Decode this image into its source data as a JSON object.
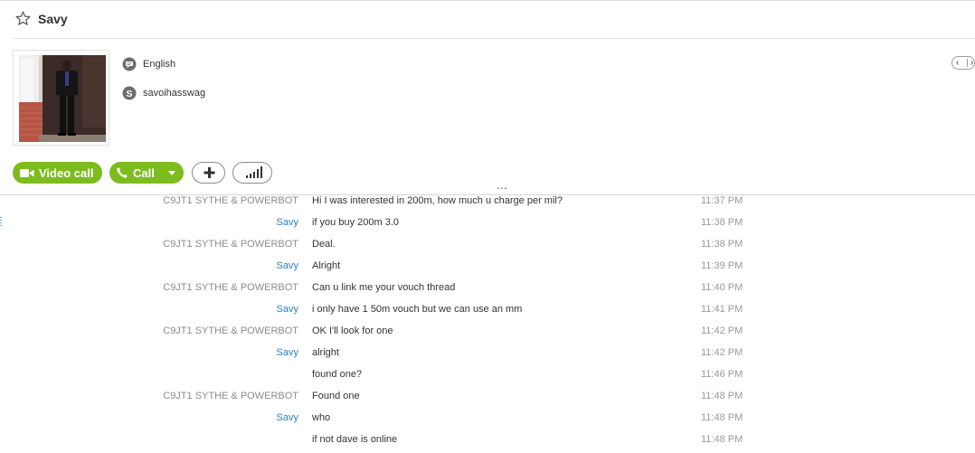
{
  "header": {
    "contact_name": "Savy"
  },
  "profile": {
    "language": "English",
    "skype_name": "savoihasswag"
  },
  "actions": {
    "video_call_label": "Video call",
    "call_label": "Call"
  },
  "colors": {
    "accent_green": "#7cbc1e",
    "self_name_blue": "#2b7ec5",
    "other_name_gray": "#8c8c8c",
    "timestamp_gray": "#9a9a9a"
  },
  "icons": [
    "star-icon",
    "chat-bubble-icon",
    "skype-icon",
    "video-camera-icon",
    "phone-icon",
    "plus-icon",
    "signal-bars-icon",
    "chevron-left-icon",
    "chevron-right-icon"
  ],
  "messages": [
    {
      "sender": "C9JT1 SYTHE & POWERBOT",
      "is_self": false,
      "text": "Hi I was interested in 200m, how much u charge per mil?",
      "time": "11:37 PM"
    },
    {
      "sender": "Savy",
      "is_self": true,
      "text": "if you buy 200m 3.0",
      "time": "11:38 PM"
    },
    {
      "sender": "C9JT1 SYTHE & POWERBOT",
      "is_self": false,
      "text": "Deal.",
      "time": "11:38 PM"
    },
    {
      "sender": "Savy",
      "is_self": true,
      "text": "Alright",
      "time": "11:39 PM"
    },
    {
      "sender": "C9JT1 SYTHE & POWERBOT",
      "is_self": false,
      "text": "Can u link me your vouch thread",
      "time": "11:40 PM"
    },
    {
      "sender": "Savy",
      "is_self": true,
      "text": "i only have 1 50m vouch but we can use an mm",
      "time": "11:41 PM"
    },
    {
      "sender": "C9JT1 SYTHE & POWERBOT",
      "is_self": false,
      "text": "OK I'll look for one",
      "time": "11:42 PM"
    },
    {
      "sender": "Savy",
      "is_self": true,
      "text": "alright",
      "time": "11:42 PM"
    },
    {
      "sender": "",
      "is_self": true,
      "text": "found one?",
      "time": "11:46 PM"
    },
    {
      "sender": "C9JT1 SYTHE & POWERBOT",
      "is_self": false,
      "text": "Found one",
      "time": "11:48 PM"
    },
    {
      "sender": "Savy",
      "is_self": true,
      "text": "who",
      "time": "11:48 PM"
    },
    {
      "sender": "",
      "is_self": true,
      "text": "if not dave is online",
      "time": "11:48 PM"
    }
  ]
}
